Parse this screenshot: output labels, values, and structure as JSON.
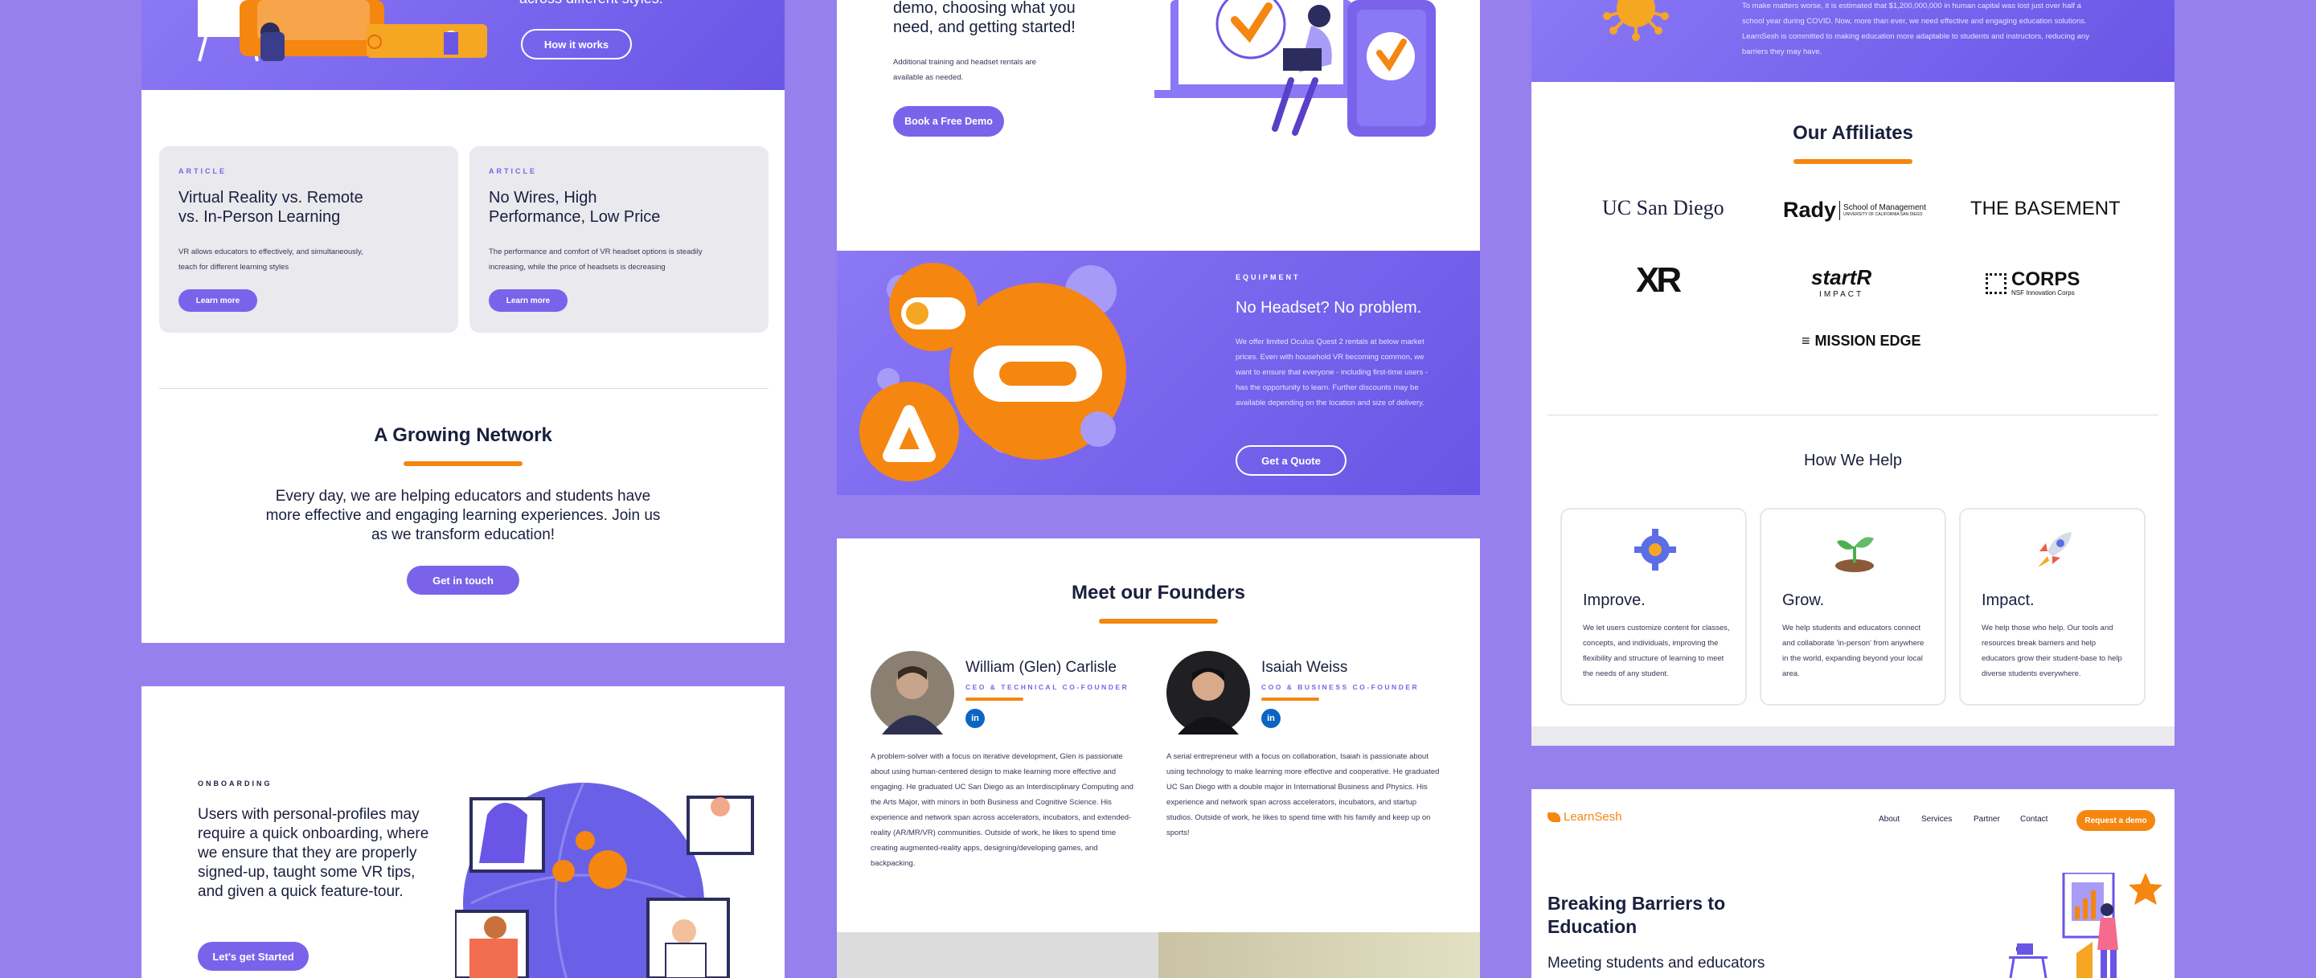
{
  "col1": {
    "hero": {
      "tail_text": "across different styles.",
      "button": "How it works"
    },
    "articles": [
      {
        "eyebrow": "ARTICLE",
        "title": "Virtual Reality vs. Remote vs. In-Person Learning",
        "body": "VR allows educators to effectively, and simultaneously, teach for different learning styles",
        "button": "Learn more"
      },
      {
        "eyebrow": "ARTICLE",
        "title": "No Wires, High Performance, Low Price",
        "body": "The performance and comfort of VR headset options is steadily increasing, while the price of headsets is decreasing",
        "button": "Learn more"
      }
    ],
    "network": {
      "title": "A Growing Network",
      "body": "Every day, we are helping educators and students have more effective and engaging learning experiences. Join us as we transform education!",
      "button": "Get in touch"
    },
    "onboarding": {
      "eyebrow": "ONBOARDING",
      "body": "Users with personal-profiles may require a quick onboarding, where we ensure that they are properly signed-up, taught some VR tips, and given a quick feature-tour.",
      "button": "Let's get Started"
    }
  },
  "col2": {
    "demo": {
      "heading": "demo, choosing what you need, and getting started!",
      "note": "Additional training and headset rentals are available as needed.",
      "button": "Book a Free Demo"
    },
    "equipment": {
      "eyebrow": "EQUIPMENT",
      "title": "No Headset? No problem.",
      "body": "We offer limited Oculus Quest 2 rentals at below market prices. Even with household VR becoming common, we want to ensure that everyone - including first-time users - has the opportunity to learn. Further discounts may be available depending on the location and size of delivery.",
      "button": "Get a Quote"
    },
    "founders": {
      "title": "Meet our Founders",
      "people": [
        {
          "name": "William (Glen) Carlisle",
          "role": "CEO & TECHNICAL CO-FOUNDER",
          "bio": "A problem-solver with a focus on iterative development, Glen is passionate about using human-centered design to make learning more effective and engaging.  He graduated UC San Diego as an Interdisciplinary Computing and the Arts Major, with minors in both Business and Cognitive Science.  His experience and network span across accelerators, incubators, and extended-reality (AR/MR/VR) communities.  Outside of work, he likes to spend time creating augmented-reality apps, designing/developing games, and backpacking."
        },
        {
          "name": "Isaiah Weiss",
          "role": "COO & BUSINESS CO-FOUNDER",
          "bio": "A serial entrepreneur with a focus on collaboration, Isaiah is passionate about using technology to make learning more effective and cooperative.  He graduated UC San Diego with a double major in International Business and Physics.  His experience and network span across accelerators, incubators, and startup studios.  Outside of work, he likes to spend time with his family and keep up on sports!"
        }
      ]
    }
  },
  "col3": {
    "covid": {
      "text": "To make matters worse, it is estimated that $1,200,000,000 in human capital was lost just over half a school year during COVID. Now, more than ever, we need effective and engaging education solutions. LearnSesh is committed to making education more adaptable to students and instructors, reducing any barriers they may have."
    },
    "affiliates": {
      "title": "Our Affiliates",
      "logos": [
        "UC San Diego",
        "Rady",
        "School of Management",
        "UNIVERSITY OF CALIFORNIA SAN DIEGO",
        "THE BASEMENT",
        "XR",
        "startR",
        "IMPACT",
        "CORPS",
        "NSF Innovation Corps",
        "MISSION EDGE"
      ]
    },
    "help": {
      "title": "How We Help",
      "cards": [
        {
          "icon": "gear-icon",
          "title": "Improve.",
          "body": "We let users customize content for classes, concepts, and individuals, improving the flexibility and structure of learning to meet the needs of any student."
        },
        {
          "icon": "sprout-icon",
          "title": "Grow.",
          "body": "We help students and educators connect and collaborate 'in-person' from anywhere in the world, expanding beyond your local area."
        },
        {
          "icon": "rocket-icon",
          "title": "Impact.",
          "body": "We help those who help. Our tools and resources break barriers and help educators grow their student-base to help diverse students everywhere."
        }
      ]
    },
    "site": {
      "logo": "LearnSesh",
      "nav": [
        "About",
        "Services",
        "Partner",
        "Contact"
      ],
      "cta": "Request a demo",
      "hero_title": "Breaking Barriers to Education",
      "hero_sub": "Meeting students and educators"
    }
  },
  "colors": {
    "bg": "#9580ee",
    "accent": "#7a63ea",
    "orange": "#f5860f",
    "navy": "#1a1f3d"
  }
}
